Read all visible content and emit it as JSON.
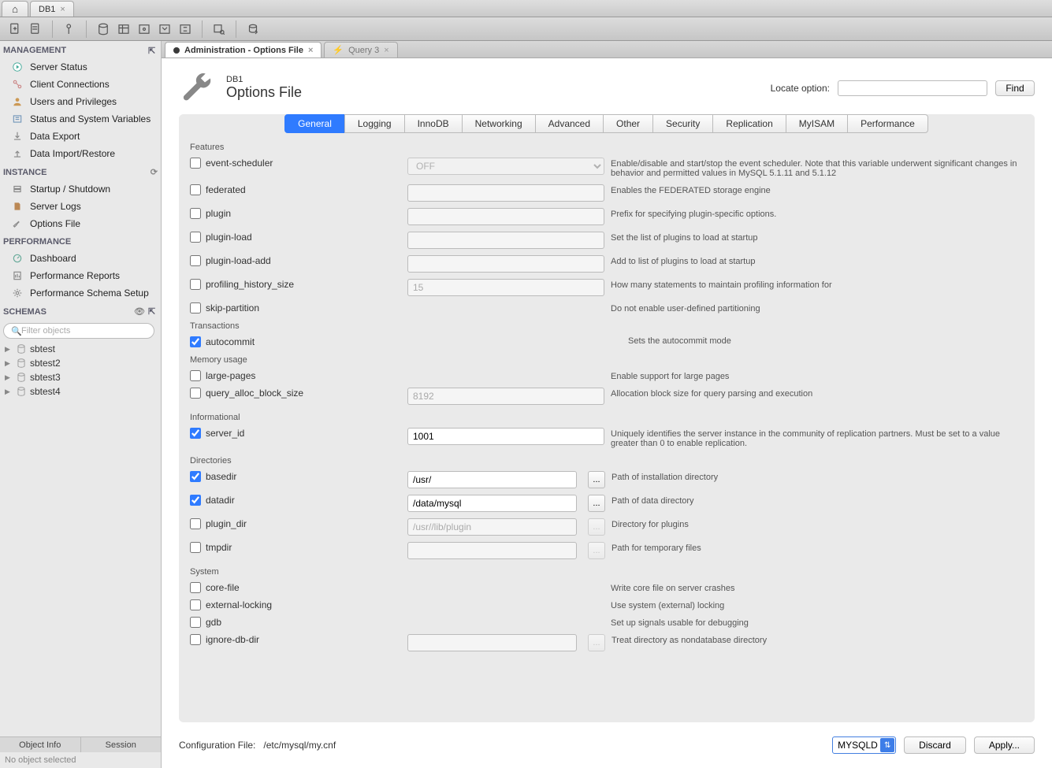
{
  "window_tabs": {
    "db1": "DB1"
  },
  "sidebar": {
    "management": {
      "header": "MANAGEMENT",
      "items": [
        "Server Status",
        "Client Connections",
        "Users and Privileges",
        "Status and System Variables",
        "Data Export",
        "Data Import/Restore"
      ]
    },
    "instance": {
      "header": "INSTANCE",
      "items": [
        "Startup / Shutdown",
        "Server Logs",
        "Options File"
      ]
    },
    "performance": {
      "header": "PERFORMANCE",
      "items": [
        "Dashboard",
        "Performance Reports",
        "Performance Schema Setup"
      ]
    },
    "schemas": {
      "header": "SCHEMAS",
      "filter_placeholder": "Filter objects",
      "items": [
        "sbtest",
        "sbtest2",
        "sbtest3",
        "sbtest4"
      ]
    },
    "bottom_tabs": [
      "Object Info",
      "Session"
    ],
    "no_obj": "No object selected"
  },
  "content_tabs": {
    "admin": "Administration - Options File",
    "query": "Query 3"
  },
  "header": {
    "sub": "DB1",
    "title": "Options File",
    "locate_label": "Locate option:",
    "find": "Find"
  },
  "opt_tabs": [
    "General",
    "Logging",
    "InnoDB",
    "Networking",
    "Advanced",
    "Other",
    "Security",
    "Replication",
    "MyISAM",
    "Performance"
  ],
  "sections": {
    "features": "Features",
    "transactions": "Transactions",
    "memory": "Memory usage",
    "informational": "Informational",
    "directories": "Directories",
    "system": "System"
  },
  "opts": {
    "event_scheduler": {
      "label": "event-scheduler",
      "val": "OFF",
      "desc": "Enable/disable and start/stop the event scheduler. Note that this variable underwent significant changes in behavior and permitted values in MySQL 5.1.11 and 5.1.12"
    },
    "federated": {
      "label": "federated",
      "desc": "Enables the FEDERATED storage engine"
    },
    "plugin": {
      "label": "plugin",
      "desc": "Prefix for specifying plugin-specific options."
    },
    "plugin_load": {
      "label": "plugin-load",
      "desc": "Set the list of plugins to load at startup"
    },
    "plugin_load_add": {
      "label": "plugin-load-add",
      "desc": "Add to list of plugins to load at startup"
    },
    "profiling": {
      "label": "profiling_history_size",
      "ph": "15",
      "desc": "How many statements to maintain profiling information for"
    },
    "skip_partition": {
      "label": "skip-partition",
      "desc": "Do not enable user-defined partitioning"
    },
    "autocommit": {
      "label": "autocommit",
      "desc": "Sets the autocommit mode"
    },
    "large_pages": {
      "label": "large-pages",
      "desc": "Enable support for large pages"
    },
    "query_alloc": {
      "label": "query_alloc_block_size",
      "ph": "8192",
      "desc": "Allocation block size for query parsing and execution"
    },
    "server_id": {
      "label": "server_id",
      "val": "1001",
      "desc": "Uniquely identifies the server instance in the community of replication partners. Must be set to a value greater than 0 to enable replication."
    },
    "basedir": {
      "label": "basedir",
      "val": "/usr/",
      "desc": "Path of installation directory"
    },
    "datadir": {
      "label": "datadir",
      "val": "/data/mysql",
      "desc": "Path of data directory"
    },
    "plugin_dir": {
      "label": "plugin_dir",
      "ph": "/usr//lib/plugin",
      "desc": "Directory for plugins"
    },
    "tmpdir": {
      "label": "tmpdir",
      "desc": "Path for temporary files"
    },
    "core_file": {
      "label": "core-file",
      "desc": "Write core file on server crashes"
    },
    "ext_lock": {
      "label": "external-locking",
      "desc": "Use system (external) locking"
    },
    "gdb": {
      "label": "gdb",
      "desc": "Set up signals usable for debugging"
    },
    "ignore_db": {
      "label": "ignore-db-dir",
      "desc": "Treat directory as nondatabase directory"
    }
  },
  "dots": "...",
  "footer": {
    "conf_label": "Configuration File:",
    "conf_path": "/etc/mysql/my.cnf",
    "section": "MYSQLD",
    "discard": "Discard",
    "apply": "Apply..."
  }
}
